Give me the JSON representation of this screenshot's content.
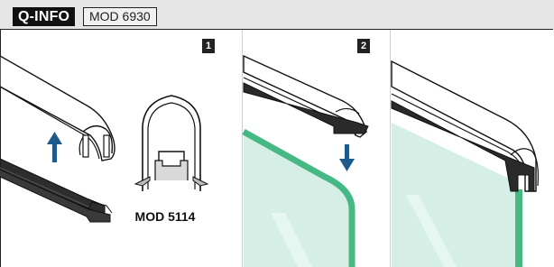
{
  "header": {
    "brand": "Q-INFO",
    "model": "MOD 6930"
  },
  "steps": [
    {
      "number": "1"
    },
    {
      "number": "2"
    }
  ],
  "profile_label": "MOD 5114",
  "colors": {
    "arrow": "#1f5a8c",
    "glass": "#bfe3d6",
    "glass_edge": "#3bb27b",
    "gasket": "#2a2a2a"
  }
}
